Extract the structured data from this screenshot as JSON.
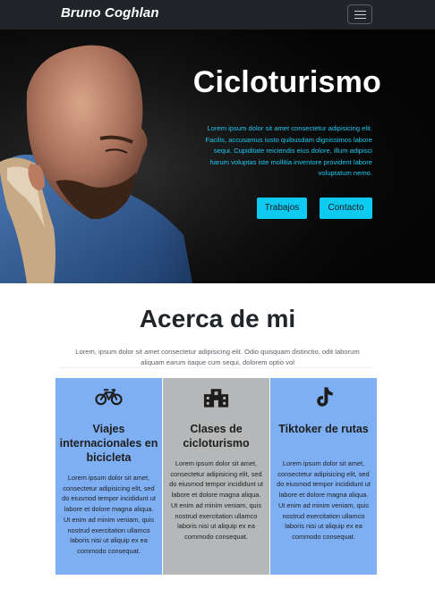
{
  "navbar": {
    "brand": "Bruno Coghlan",
    "toggler_icon": "hamburger-menu-icon"
  },
  "hero": {
    "title": "Cicloturismo",
    "text": "Lorem ipsum dolor sit amet consectetur adipisicing elit. Facilis, accusamus iusto quibusdam dignissimos labore sequi. Cupiditate reiciendis eius dolore, illum adipisci harum voluptas iste mollitia inventore provident labore voluptatum nemo.",
    "buttons": [
      {
        "label": "Trabajos"
      },
      {
        "label": "Contacto"
      }
    ],
    "text_color": "#1ec8f0",
    "button_color": "#0dcaf0"
  },
  "about": {
    "title": "Acerca de mi",
    "text": "Lorem, ipsum dolor sit amet consectetur adipisicing elit. Odio quisquam distinctio, odit laborum aliquam earum itaque cum sequi, dolorem optio vol",
    "cards": [
      {
        "icon": "bicycle-icon",
        "title": "Viajes internacionales en bicicleta",
        "text": "Lorem ipsum dolor sit amet, consectetur adipisicing elit, sed do eiusmod tempor incididunt ut labore et dolore magna aliqua. Ut enim ad minim veniam, quis nostrud exercitation ullamco laboris nisi ut aliquip ex ea commodo consequat.",
        "color": "#7eaff3"
      },
      {
        "icon": "building-icon",
        "title": "Clases de cicloturismo",
        "text": "Lorem ipsum dolor sit amet, consectetur adipisicing elit, sed do eiusmod tempor incididunt ut labore et dolore magna aliqua. Ut enim ad minim veniam, quis nostrud exercitation ullamco laboris nisi ut aliquip ex ea commodo consequat.",
        "color": "#b5b7b9"
      },
      {
        "icon": "tiktok-icon",
        "title": "Tiktoker de rutas",
        "text": "Lorem ipsum dolor sit amet, consectetur adipisicing elit, sed do eiusmod tempor incididunt ut labore et dolore magna aliqua. Ut enim ad minim veniam, quis nostrud exercitation ullamco laboris nisi ut aliquip ex ea commodo consequat.",
        "color": "#7eaff3"
      }
    ]
  }
}
